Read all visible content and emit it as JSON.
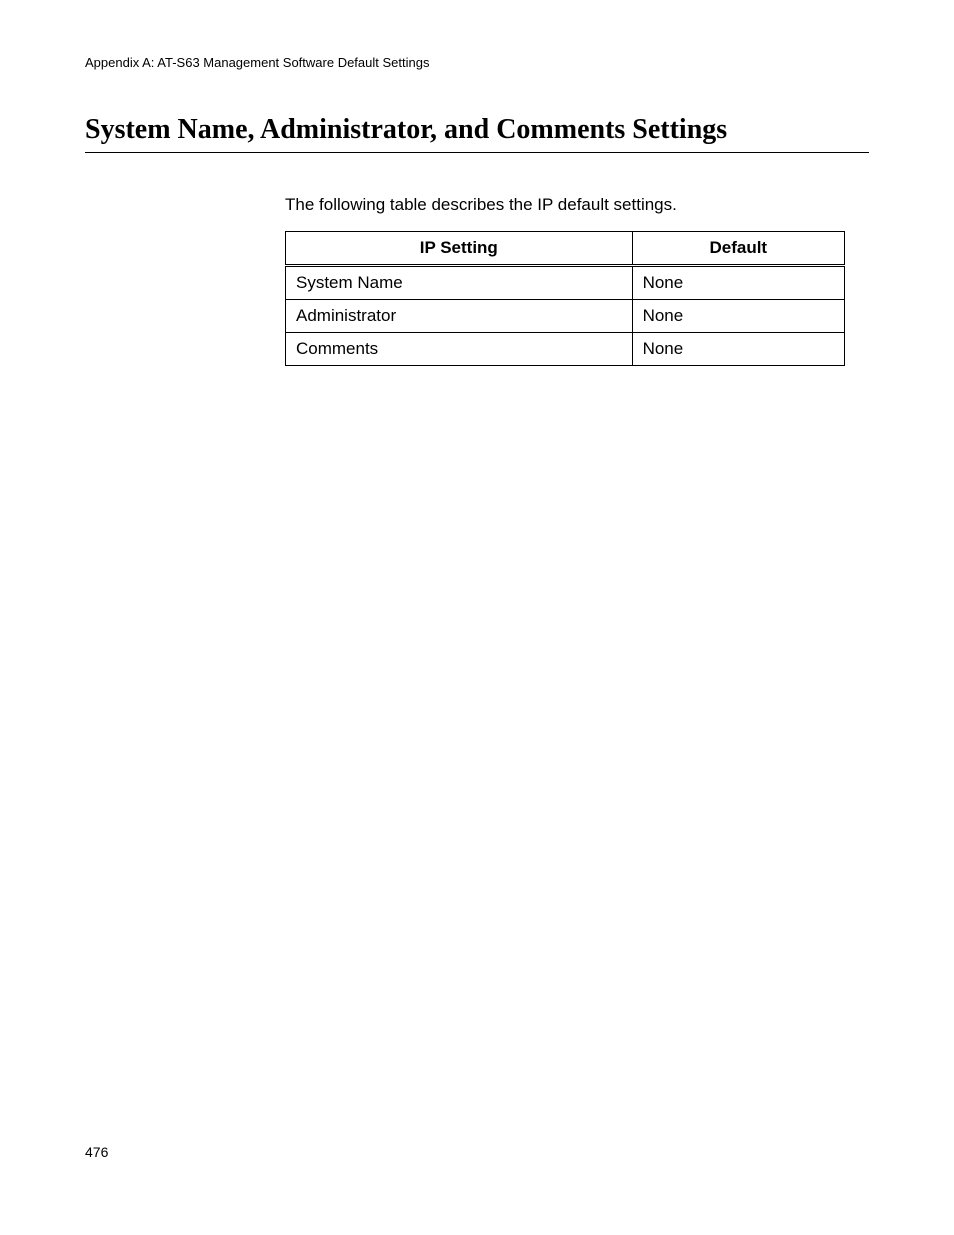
{
  "header": {
    "running_head": "Appendix A: AT-S63 Management Software Default Settings"
  },
  "section": {
    "title": "System Name, Administrator, and Comments Settings",
    "intro": "The following table describes the IP default settings."
  },
  "table": {
    "headers": {
      "setting": "IP Setting",
      "default": "Default"
    },
    "rows": [
      {
        "setting": "System Name",
        "default": "None"
      },
      {
        "setting": "Administrator",
        "default": "None"
      },
      {
        "setting": "Comments",
        "default": "None"
      }
    ]
  },
  "footer": {
    "page_number": "476"
  }
}
